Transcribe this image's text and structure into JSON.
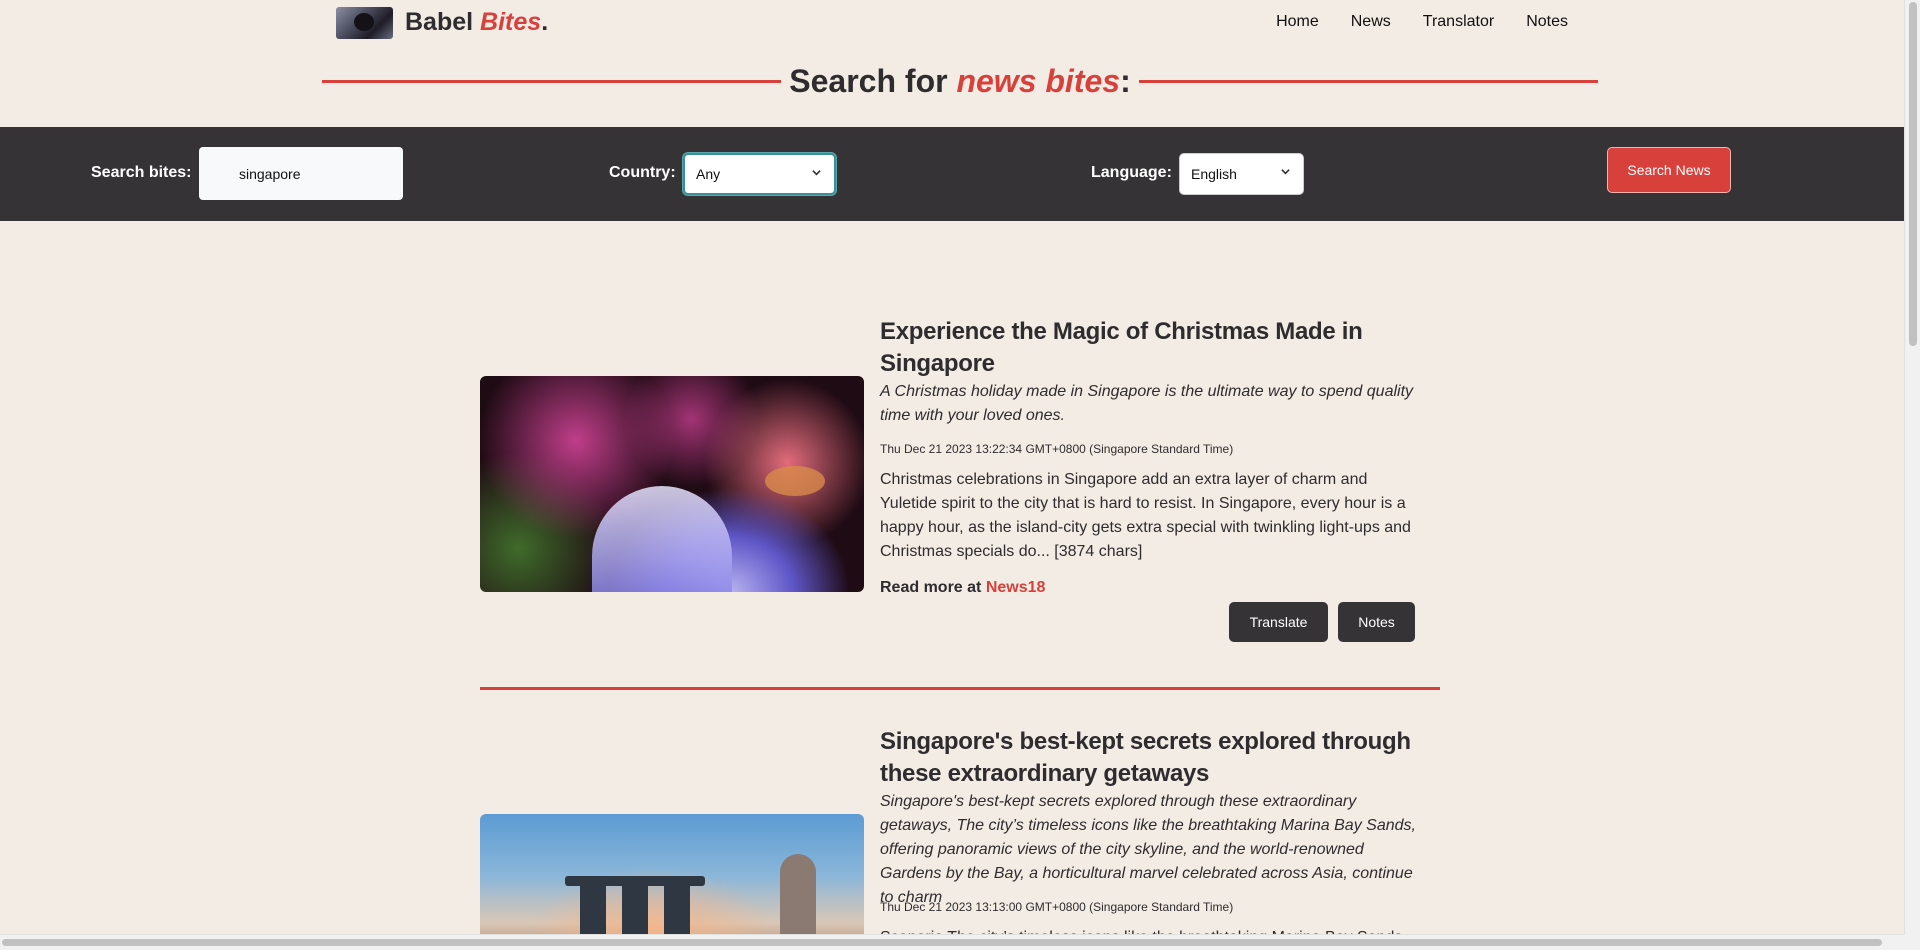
{
  "header": {
    "brand_main": "Babel",
    "brand_accent": "Bites",
    "brand_dot": ".",
    "nav": [
      "Home",
      "News",
      "Translator",
      "Notes"
    ]
  },
  "heading": {
    "prefix": "Search for",
    "accent": "news bites",
    "suffix": ":"
  },
  "search": {
    "label": "Search bites:",
    "value": "singapore",
    "country_label": "Country:",
    "country_value": "Any",
    "language_label": "Language:",
    "language_value": "English",
    "button": "Search News"
  },
  "articles": [
    {
      "title": "Experience the Magic of Christmas Made in Singapore",
      "description": "A Christmas holiday made in Singapore is the ultimate way to spend quality time with your loved ones.",
      "date": "Thu Dec 21 2023 13:22:34 GMT+0800 (Singapore Standard Time)",
      "body": "Christmas celebrations in Singapore add an extra layer of charm and Yuletide spirit to the city that is hard to resist. In Singapore, every hour is a happy hour, as the island-city gets extra special with twinkling light-ups and Christmas specials do... [3874 chars]",
      "read_more_prefix": "Read more at",
      "source": "News18",
      "translate_label": "Translate",
      "notes_label": "Notes"
    },
    {
      "title": "Singapore's best-kept secrets explored through these extraordinary getaways",
      "description": "Singapore's best-kept secrets explored through these extraordinary getaways, The city’s timeless icons like the breathtaking Marina Bay Sands, offering panoramic views of the city skyline, and the world-renowned Gardens by the Bay, a horticultural marvel celebrated across Asia, continue to charm",
      "date": "Thu Dec 21 2023 13:13:00 GMT+0800 (Singapore Standard Time)",
      "body": "Scenario The city’s timeless icons like the breathtaking Marina Bay Sands"
    }
  ],
  "colors": {
    "accent": "#d8403b",
    "dark": "#353335",
    "background": "#f3ece4"
  }
}
